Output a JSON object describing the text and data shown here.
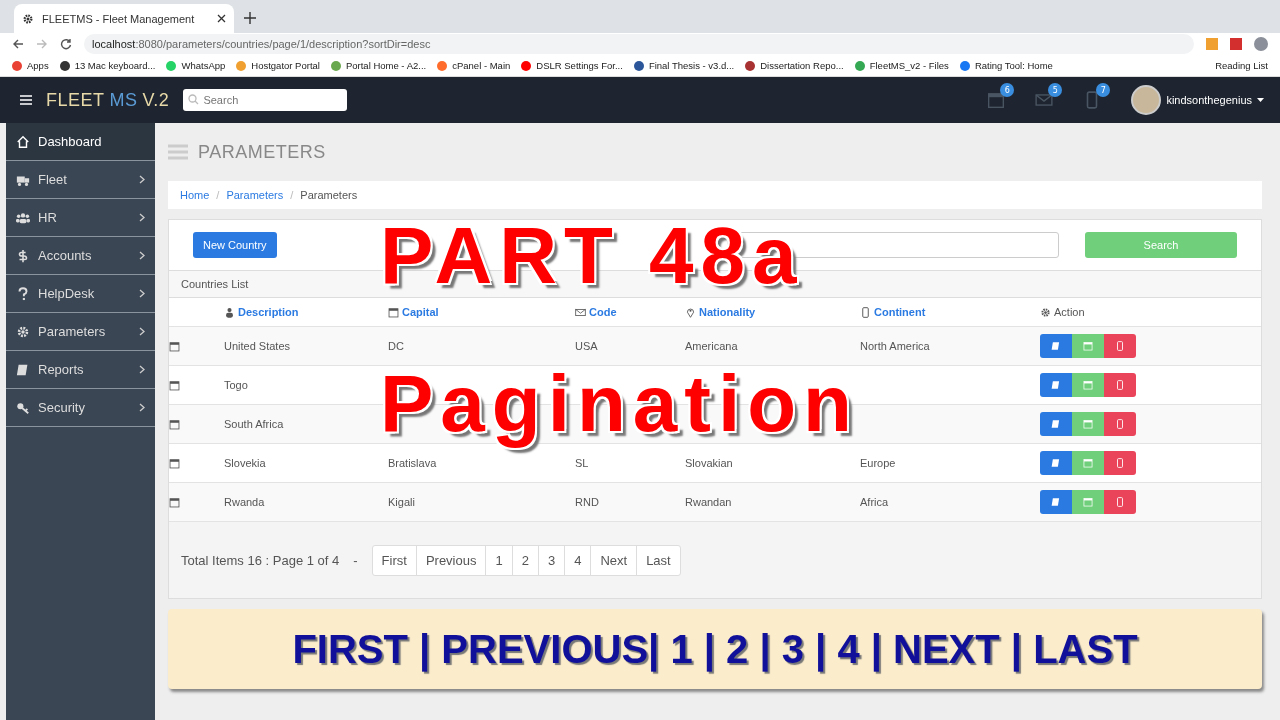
{
  "browser": {
    "tab_title": "FLEETMS - Fleet Management",
    "url_host": "localhost",
    "url_rest": ":8080/parameters/countries/page/1/description?sortDir=desc",
    "bookmarks": [
      {
        "label": "Apps",
        "color": "#e94235"
      },
      {
        "label": "13 Mac keyboard...",
        "color": "#333333"
      },
      {
        "label": "WhatsApp",
        "color": "#25d366"
      },
      {
        "label": "Hostgator Portal",
        "color": "#f0a030"
      },
      {
        "label": "Portal Home - A2...",
        "color": "#6aa84f"
      },
      {
        "label": "cPanel - Main",
        "color": "#ff6c2c"
      },
      {
        "label": "DSLR Settings For...",
        "color": "#ff0000"
      },
      {
        "label": "Final Thesis - v3.d...",
        "color": "#2b579a"
      },
      {
        "label": "Dissertation Repo...",
        "color": "#a83232"
      },
      {
        "label": "FleetMS_v2 - Files",
        "color": "#34a853"
      },
      {
        "label": "Rating Tool: Home",
        "color": "#1877f2"
      }
    ],
    "reading_list": "Reading List"
  },
  "header": {
    "brand_a": "FLEET",
    "brand_b": "MS",
    "brand_c": "V.2",
    "search_placeholder": "Search",
    "badges": [
      "6",
      "5",
      "7"
    ],
    "user": "kindsonthegenius"
  },
  "sidebar": {
    "items": [
      {
        "label": "Dashboard",
        "selected": true
      },
      {
        "label": "Fleet",
        "selected": false
      },
      {
        "label": "HR",
        "selected": false
      },
      {
        "label": "Accounts",
        "selected": false
      },
      {
        "label": "HelpDesk",
        "selected": false
      },
      {
        "label": "Parameters",
        "selected": false
      },
      {
        "label": "Reports",
        "selected": false
      },
      {
        "label": "Security",
        "selected": false
      }
    ]
  },
  "page_title": "PARAMETERS",
  "breadcrumb": [
    "Home",
    "Parameters",
    "Parameters"
  ],
  "breadcrumb_separator": "/",
  "new_button": "New Country",
  "search_button": "Search",
  "list_title": "Countries List",
  "table": {
    "columns": [
      "Description",
      "Capital",
      "Code",
      "Nationality",
      "Continent",
      "Action"
    ],
    "rows": [
      {
        "description": "United States",
        "capital": "DC",
        "code": "USA",
        "nationality": "Americana",
        "continent": "North America"
      },
      {
        "description": "Togo"
      },
      {
        "description": "South Africa"
      },
      {
        "description": "Slovekia",
        "capital": "Bratislava",
        "code": "SL",
        "nationality": "Slovakian",
        "continent": "Europe"
      },
      {
        "description": "Rwanda",
        "capital": "Kigali",
        "code": "RND",
        "nationality": "Rwandan",
        "continent": "Africa"
      }
    ]
  },
  "pagination": {
    "summary": "Total Items 16 : Page 1 of 4",
    "dash": "-",
    "links": [
      "First",
      "Previous",
      "1",
      "2",
      "3",
      "4",
      "Next",
      "Last"
    ]
  },
  "overlay": {
    "line_1": "PART 48a",
    "line_2": "Pagination",
    "banner": "FIRST | PREVIOUS| 1 | 2 | 3 | 4 | NEXT | LAST"
  }
}
